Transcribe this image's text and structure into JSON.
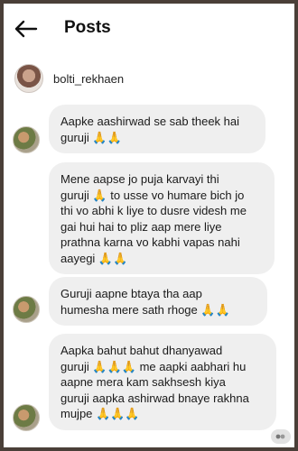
{
  "header": {
    "title": "Posts"
  },
  "author": {
    "username": "bolti_rekhaen"
  },
  "messages": [
    {
      "text": "Aapke aashirwad se sab theek hai\nguruji 🙏🙏"
    },
    {
      "text": "Mene aapse jo puja karvayi thi\nguruji 🙏 to usse vo humare bich jo\nthi vo abhi k liye to dusre videsh me\ngai hui hai to pliz aap mere liye\nprathna karna vo kabhi vapas nahi\naayegi 🙏🙏"
    },
    {
      "text": "Guruji aapne btaya tha aap\nhumesha mere sath rhoge 🙏🙏"
    },
    {
      "text": "Aapka bahut bahut dhanyawad\nguruji 🙏🙏🙏 me aapki aabhari hu\naapne mera kam sakhsesh kiya\nguruji aapka ashirwad bnaye rakhna\nmujpe 🙏🙏🙏"
    }
  ]
}
